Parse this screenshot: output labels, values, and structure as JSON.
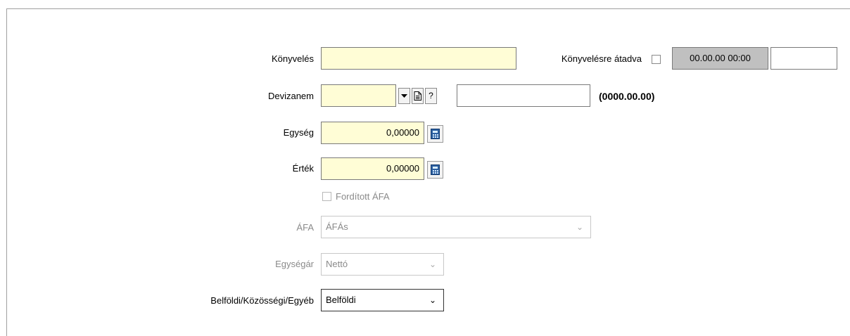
{
  "fields": {
    "konyveles": {
      "label": "Könyvelés",
      "value": ""
    },
    "konyvelesre_atadva": {
      "label": "Könyvelésre átadva",
      "checked": false,
      "datetime": "00.00.00 00:00",
      "extra": ""
    },
    "devizanem": {
      "label": "Devizanem",
      "value": "",
      "help": "?",
      "desc": "",
      "date_hint": "(0000.00.00)"
    },
    "egyseg": {
      "label": "Egység",
      "value": "0,00000"
    },
    "ertek": {
      "label": "Érték",
      "value": "0,00000"
    },
    "forditott_afa": {
      "label": "Fordított ÁFA",
      "checked": false
    },
    "afa": {
      "label": "ÁFA",
      "value": "ÁFÁs"
    },
    "egysegar": {
      "label": "Egységár",
      "value": "Nettó"
    },
    "belfoldi": {
      "label": "Belföldi/Közösségi/Egyéb",
      "value": "Belföldi"
    }
  },
  "icons": {
    "dropdown": "dropdown-arrow-icon",
    "document": "document-icon",
    "calculator": "calculator-icon",
    "chevron": "chevron-down-icon"
  },
  "colors": {
    "required_field": "#fffdd6",
    "disabled_text": "#8a8a8a",
    "readonly_field": "#c0c0c0"
  }
}
